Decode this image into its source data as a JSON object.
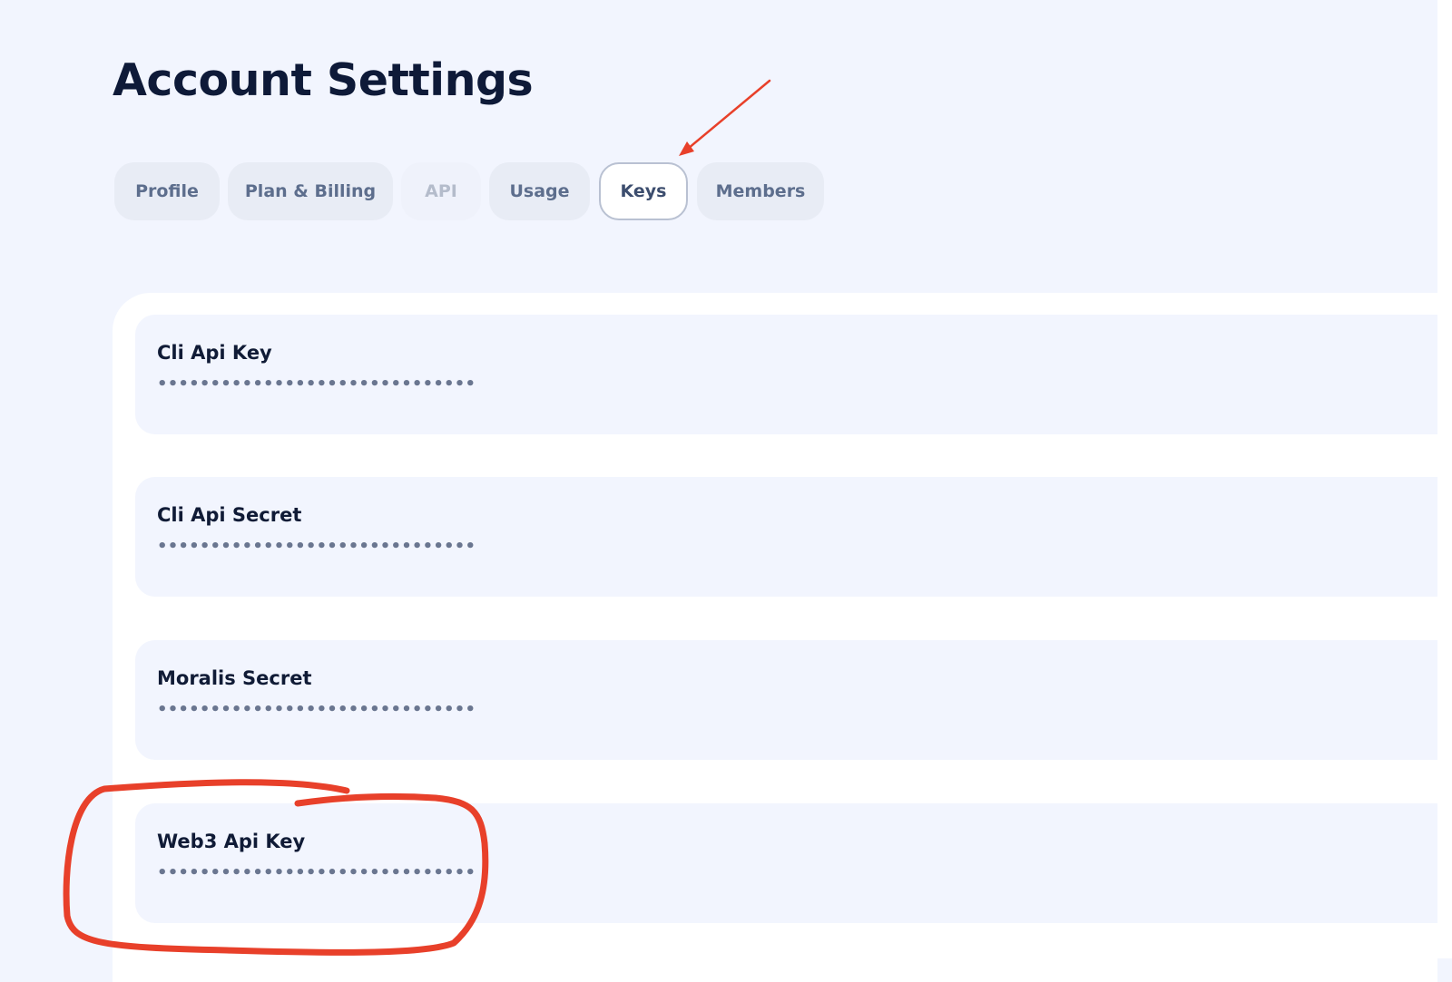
{
  "page": {
    "title": "Account Settings"
  },
  "tabs": {
    "profile": "Profile",
    "billing": "Plan & Billing",
    "api": "API",
    "usage": "Usage",
    "keys": "Keys",
    "members": "Members",
    "active": "Keys",
    "disabled": "API"
  },
  "keys": [
    {
      "label": "Cli Api Key",
      "value": "••••••••••••••••••••••••••••••"
    },
    {
      "label": "Cli Api Secret",
      "value": "••••••••••••••••••••••••••••••"
    },
    {
      "label": "Moralis Secret",
      "value": "••••••••••••••••••••••••••••••"
    },
    {
      "label": "Web3 Api Key",
      "value": "••••••••••••••••••••••••••••••"
    }
  ],
  "annotations": {
    "color": "#e8402a",
    "arrow_target": "Keys",
    "circled_item": "Web3 Api Key"
  },
  "colors": {
    "background": "#f2f5fe",
    "title": "#0e1a38",
    "tab_bg": "#e8ecf5",
    "tab_text": "#5d6e8d",
    "card_bg": "#f2f5fe",
    "panel_bg": "#ffffff"
  }
}
